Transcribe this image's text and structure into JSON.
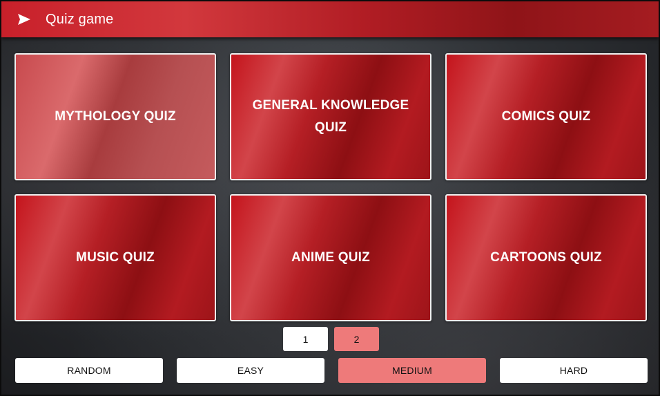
{
  "header": {
    "icon": "send-icon",
    "title": "Quiz game"
  },
  "colors": {
    "header_red": "#c8202a",
    "card_red": "#b51f25",
    "active_pink": "#ee7a7a",
    "button_white": "#ffffff"
  },
  "quizzes": [
    {
      "label": "MYTHOLOGY QUIZ"
    },
    {
      "label": "GENERAL KNOWLEDGE QUIZ"
    },
    {
      "label": "COMICS QUIZ"
    },
    {
      "label": "MUSIC QUIZ"
    },
    {
      "label": "ANIME QUIZ"
    },
    {
      "label": "CARTOONS QUIZ"
    }
  ],
  "pagination": {
    "pages": [
      "1",
      "2"
    ],
    "current": "2"
  },
  "difficulty": {
    "options": [
      "RANDOM",
      "EASY",
      "MEDIUM",
      "HARD"
    ],
    "selected": "MEDIUM"
  }
}
